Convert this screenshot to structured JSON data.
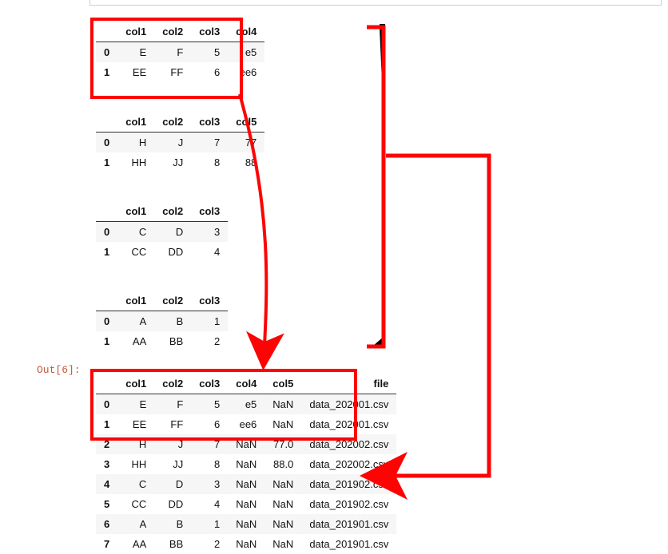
{
  "output_label": "Out[6]:",
  "tables": {
    "a": {
      "cols": [
        "col1",
        "col2",
        "col3",
        "col4"
      ],
      "rows": [
        [
          "E",
          "F",
          "5",
          "e5"
        ],
        [
          "EE",
          "FF",
          "6",
          "ee6"
        ]
      ]
    },
    "b": {
      "cols": [
        "col1",
        "col2",
        "col3",
        "col5"
      ],
      "rows": [
        [
          "H",
          "J",
          "7",
          "77"
        ],
        [
          "HH",
          "JJ",
          "8",
          "88"
        ]
      ]
    },
    "c": {
      "cols": [
        "col1",
        "col2",
        "col3"
      ],
      "rows": [
        [
          "C",
          "D",
          "3"
        ],
        [
          "CC",
          "DD",
          "4"
        ]
      ]
    },
    "d": {
      "cols": [
        "col1",
        "col2",
        "col3"
      ],
      "rows": [
        [
          "A",
          "B",
          "1"
        ],
        [
          "AA",
          "BB",
          "2"
        ]
      ]
    },
    "out": {
      "cols": [
        "col1",
        "col2",
        "col3",
        "col4",
        "col5",
        "file"
      ],
      "rows": [
        [
          "E",
          "F",
          "5",
          "e5",
          "NaN",
          "data_202001.csv"
        ],
        [
          "EE",
          "FF",
          "6",
          "ee6",
          "NaN",
          "data_202001.csv"
        ],
        [
          "H",
          "J",
          "7",
          "NaN",
          "77.0",
          "data_202002.csv"
        ],
        [
          "HH",
          "JJ",
          "8",
          "NaN",
          "88.0",
          "data_202002.csv"
        ],
        [
          "C",
          "D",
          "3",
          "NaN",
          "NaN",
          "data_201902.csv"
        ],
        [
          "CC",
          "DD",
          "4",
          "NaN",
          "NaN",
          "data_201902.csv"
        ],
        [
          "A",
          "B",
          "1",
          "NaN",
          "NaN",
          "data_201901.csv"
        ],
        [
          "AA",
          "BB",
          "2",
          "NaN",
          "NaN",
          "data_201901.csv"
        ]
      ]
    }
  }
}
